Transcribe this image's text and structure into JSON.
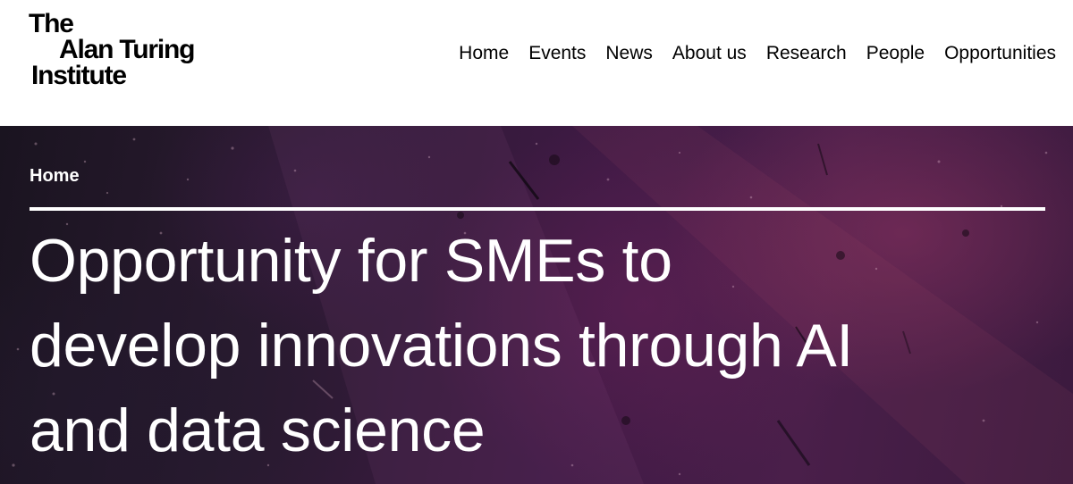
{
  "logo": {
    "line1": "The",
    "line2": "Alan Turing",
    "line3": "Institute"
  },
  "nav": {
    "items": [
      {
        "label": "Home"
      },
      {
        "label": "Events"
      },
      {
        "label": "News"
      },
      {
        "label": "About us"
      },
      {
        "label": "Research"
      },
      {
        "label": "People"
      },
      {
        "label": "Opportunities"
      }
    ]
  },
  "hero": {
    "breadcrumb": "Home",
    "title_lines": [
      "Opportunity for SMEs to",
      "develop innovations through AI",
      "and data science"
    ]
  },
  "colors": {
    "header_bg": "#ffffff",
    "text_dark": "#000000",
    "hero_text": "#ffffff",
    "hero_bg_dark": "#1a1420",
    "hero_bg_purple": "#4a1f4a"
  }
}
